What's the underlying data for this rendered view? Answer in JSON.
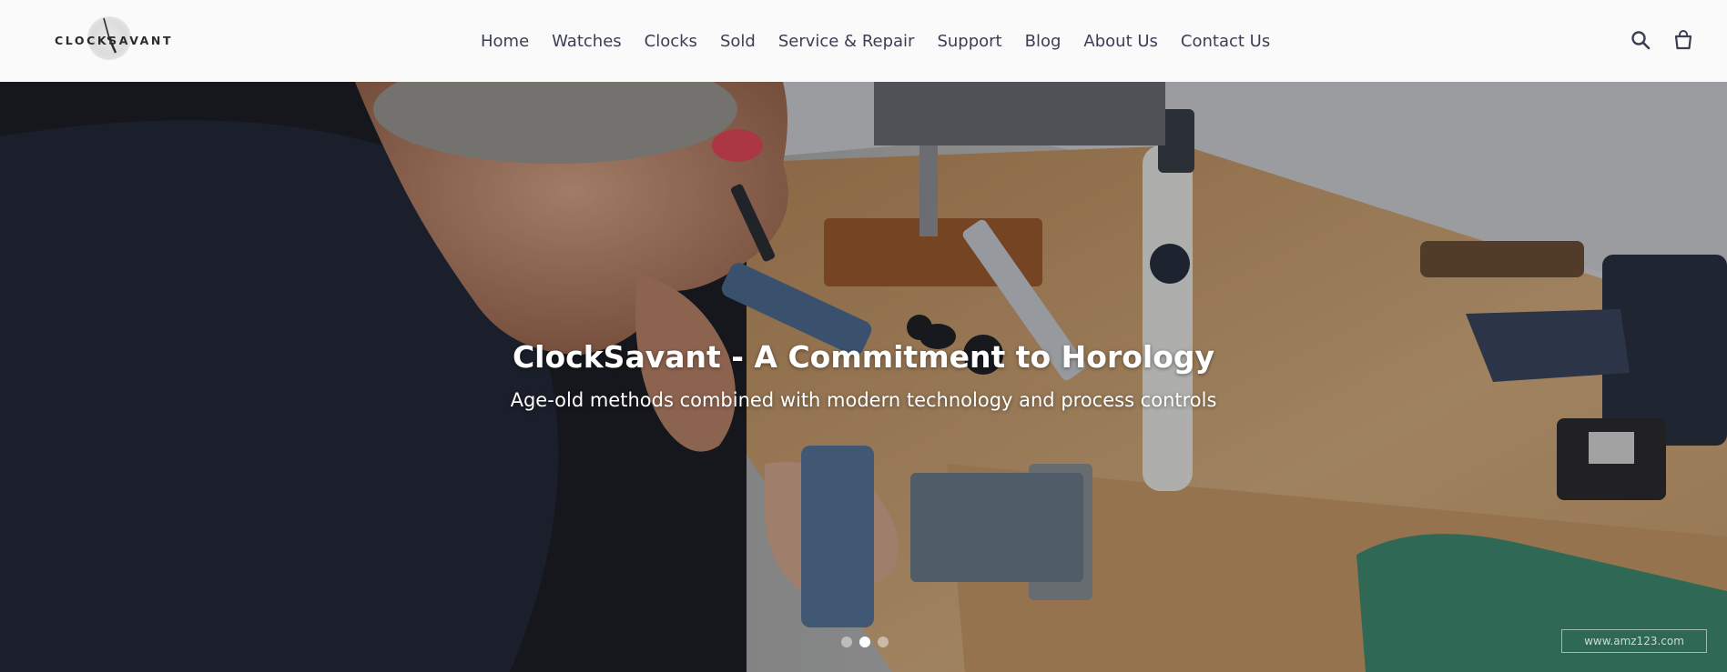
{
  "brand": {
    "logo_text": "CLOCKSAVANT"
  },
  "nav": {
    "items": [
      {
        "label": "Home"
      },
      {
        "label": "Watches"
      },
      {
        "label": "Clocks"
      },
      {
        "label": "Sold"
      },
      {
        "label": "Service & Repair"
      },
      {
        "label": "Support"
      },
      {
        "label": "Blog"
      },
      {
        "label": "About Us"
      },
      {
        "label": "Contact Us"
      }
    ]
  },
  "header_icons": {
    "search": "search-icon",
    "cart": "cart-icon"
  },
  "hero": {
    "title": "ClockSavant - A Commitment to Horology",
    "subtitle": "Age-old methods combined with modern technology and process controls",
    "slides": {
      "count": 3,
      "active_index": 1
    }
  },
  "watermark": "www.amz123.com",
  "colors": {
    "nav_text": "#3b3f54",
    "header_bg": "#fafafa",
    "hero_text": "#ffffff"
  }
}
